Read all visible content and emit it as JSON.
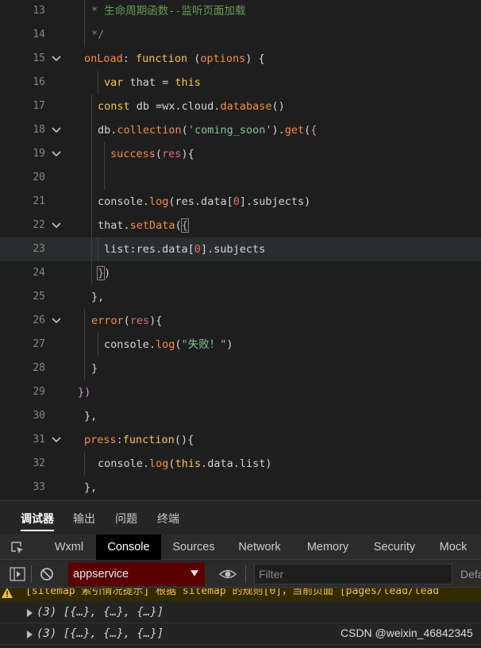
{
  "editor": {
    "lines": [
      {
        "num": "13",
        "tokens": [
          [
            "cm",
            "* 生命周期函数--监听页面加载"
          ]
        ]
      },
      {
        "num": "14",
        "tokens": [
          [
            "cm",
            "*/"
          ]
        ]
      },
      {
        "num": "15",
        "tokens": [
          [
            "fn",
            "onLoad"
          ],
          [
            "pun",
            ": "
          ],
          [
            "kw",
            "function"
          ],
          [
            "pun",
            " ("
          ],
          [
            "fn",
            "options"
          ],
          [
            "pun",
            ") {"
          ]
        ]
      },
      {
        "num": "16",
        "tokens": [
          [
            "kw",
            "var"
          ],
          [
            "id",
            " that = "
          ],
          [
            "kw",
            "this"
          ]
        ]
      },
      {
        "num": "17",
        "tokens": [
          [
            "kw",
            "const"
          ],
          [
            "id",
            " db =wx.cloud."
          ],
          [
            "fn",
            "database"
          ],
          [
            "pun",
            "()"
          ]
        ]
      },
      {
        "num": "18",
        "tokens": [
          [
            "id",
            "db."
          ],
          [
            "fn",
            "collection"
          ],
          [
            "pun",
            "("
          ],
          [
            "str",
            "'coming_soon'"
          ],
          [
            "pun",
            ")."
          ],
          [
            "fn",
            "get"
          ],
          [
            "pun",
            "("
          ],
          [
            "def",
            "{"
          ]
        ]
      },
      {
        "num": "19",
        "tokens": [
          [
            "fn",
            "success"
          ],
          [
            "pun",
            "("
          ],
          [
            "par",
            "res"
          ],
          [
            "pun",
            "){"
          ]
        ]
      },
      {
        "num": "20",
        "tokens": []
      },
      {
        "num": "21",
        "tokens": [
          [
            "id",
            "console."
          ],
          [
            "fn",
            "log"
          ],
          [
            "pun",
            "(res.data["
          ],
          [
            "par",
            "0"
          ],
          [
            "pun",
            "].subjects)"
          ]
        ]
      },
      {
        "num": "22",
        "tokens": [
          [
            "id",
            "that."
          ],
          [
            "fn",
            "setData"
          ],
          [
            "pun",
            "("
          ],
          [
            "def",
            "{"
          ]
        ]
      },
      {
        "num": "23",
        "tokens": [
          [
            "id",
            "list"
          ],
          [
            "pun",
            ":res.data["
          ],
          [
            "par",
            "0"
          ],
          [
            "pun",
            "].subjects"
          ]
        ]
      },
      {
        "num": "24",
        "tokens": [
          [
            "def",
            "}"
          ],
          [
            "pun",
            ")"
          ]
        ]
      },
      {
        "num": "25",
        "tokens": [
          [
            "pun",
            "},"
          ]
        ]
      },
      {
        "num": "26",
        "tokens": [
          [
            "fn",
            "error"
          ],
          [
            "pun",
            "("
          ],
          [
            "par",
            "res"
          ],
          [
            "pun",
            "){"
          ]
        ]
      },
      {
        "num": "27",
        "tokens": [
          [
            "id",
            "console."
          ],
          [
            "fn",
            "log"
          ],
          [
            "pun",
            "("
          ],
          [
            "str",
            "\"失败！\""
          ],
          [
            "pun",
            ")"
          ]
        ]
      },
      {
        "num": "28",
        "tokens": [
          [
            "pun",
            "}"
          ]
        ]
      },
      {
        "num": "29",
        "tokens": [
          [
            "def",
            "})"
          ]
        ]
      },
      {
        "num": "30",
        "tokens": [
          [
            "pun",
            "},"
          ]
        ]
      },
      {
        "num": "31",
        "tokens": [
          [
            "fn",
            "press"
          ],
          [
            "pun",
            ":"
          ],
          [
            "kw",
            "function"
          ],
          [
            "pun",
            "(){"
          ]
        ]
      },
      {
        "num": "32",
        "tokens": [
          [
            "id",
            "console."
          ],
          [
            "fn",
            "log"
          ],
          [
            "pun",
            "("
          ],
          [
            "kw",
            "this"
          ],
          [
            "pun",
            ".data.list)"
          ]
        ]
      },
      {
        "num": "33",
        "tokens": [
          [
            "pun",
            "},"
          ]
        ]
      }
    ]
  },
  "devtools": {
    "panel_tabs": [
      "调试器",
      "输出",
      "问题",
      "终端"
    ],
    "tool_tabs": [
      "Wxml",
      "Console",
      "Sources",
      "Network",
      "Memory",
      "Security",
      "Mock"
    ],
    "context_select": "appservice",
    "filter_placeholder": "Filter",
    "levels_label": "Defa",
    "warning_text": "[sitemap 索引情况提示] 根据 sitemap 的规则[0]，当前页面 [pages/lead/lead",
    "log_entries": [
      "(3) [{…}, {…}, {…}]",
      "(3) [{…}, {…}, {…}]"
    ],
    "watermark": "CSDN @weixin_46842345"
  },
  "icons": {
    "fold": "chevron-down-icon",
    "inspect": "inspect-element-icon",
    "sidebar": "sidebar-toggle-icon",
    "clear": "clear-console-icon",
    "eye": "eye-icon",
    "warning": "warning-icon",
    "expand": "expand-triangle-icon"
  },
  "colors": {
    "editor_bg": "#1e1e1e",
    "keyword": "#f8c555",
    "function": "#f08d49",
    "string": "#7ec699",
    "comment": "#6a9955",
    "context_select_bg": "#5a0000",
    "warning": "#f2c14e"
  }
}
